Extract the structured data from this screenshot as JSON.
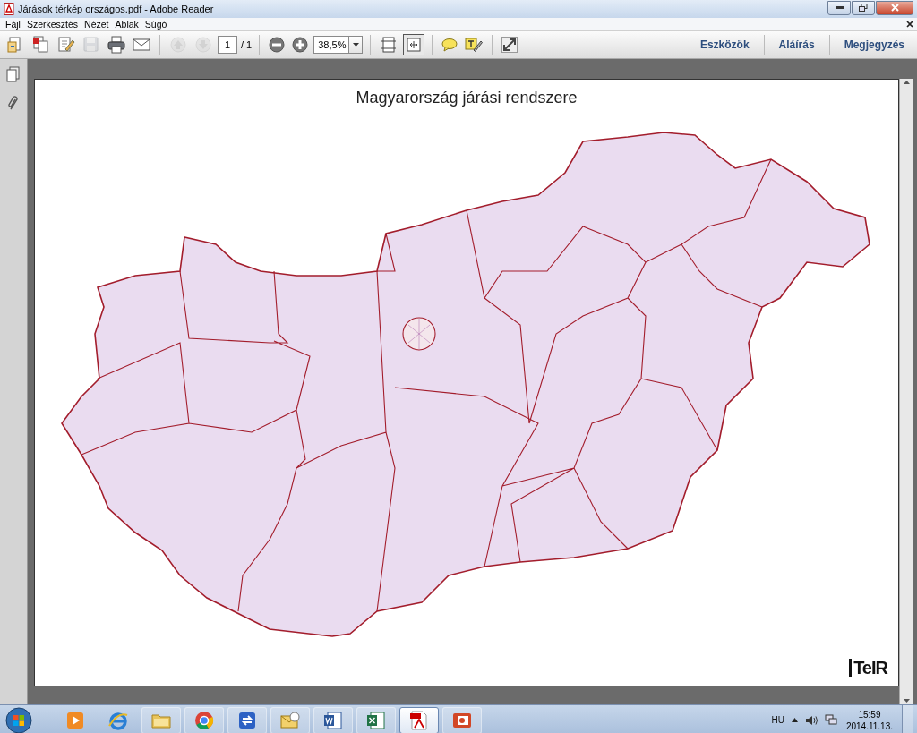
{
  "window": {
    "title": "Járások térkép országos.pdf - Adobe Reader"
  },
  "menu": [
    "Fájl",
    "Szerkesztés",
    "Nézet",
    "Ablak",
    "Súgó"
  ],
  "toolbar": {
    "tools": [
      {
        "kind": "create",
        "disabled": false
      },
      {
        "kind": "combine",
        "disabled": false
      },
      {
        "kind": "edit",
        "disabled": false
      },
      {
        "kind": "save",
        "disabled": true
      },
      {
        "kind": "print",
        "disabled": false
      },
      {
        "kind": "email",
        "disabled": false
      },
      {
        "kind": "prev",
        "disabled": true
      },
      {
        "kind": "next",
        "disabled": true
      }
    ],
    "page_field": {
      "value": "1"
    },
    "page_total": "/ 1",
    "zoom_field": {
      "value": "38,5%"
    },
    "view_tools": [
      {
        "kind": "scroll",
        "selected": false
      },
      {
        "kind": "fit",
        "selected": true
      }
    ],
    "panel_buttons": [
      "Eszközök",
      "Aláírás",
      "Megjegyzés"
    ]
  },
  "document": {
    "title": "Magyarország járási rendszere",
    "logo": "TeIR"
  },
  "taskbar": {
    "apps": [
      {
        "kind": "media",
        "selected": false
      },
      {
        "kind": "ie",
        "selected": false
      },
      {
        "kind": "folder",
        "selected": false
      },
      {
        "kind": "chrome",
        "selected": false
      },
      {
        "kind": "remote",
        "selected": false
      },
      {
        "kind": "mail",
        "selected": false
      },
      {
        "kind": "word",
        "selected": false
      },
      {
        "kind": "excel",
        "selected": false
      },
      {
        "kind": "pdf",
        "selected": true
      },
      {
        "kind": "slides",
        "selected": false
      }
    ],
    "language": "HU",
    "time": "15:59",
    "date": "2014.11.13."
  }
}
